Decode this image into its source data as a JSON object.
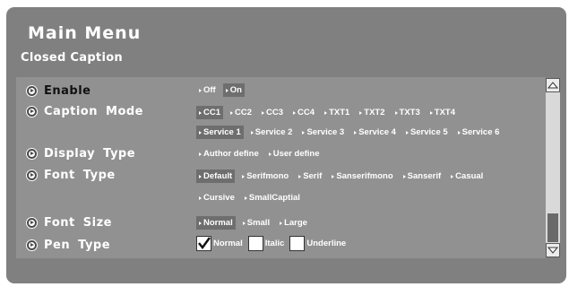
{
  "title": "Main Menu",
  "subtitle": "Closed Caption",
  "rows": [
    {
      "label": "Enable",
      "options": [
        "Off",
        "On"
      ]
    },
    {
      "label": "Caption Mode",
      "options": [
        "CC1",
        "CC2",
        "CC3",
        "CC4",
        "TXT1",
        "TXT2",
        "TXT3",
        "TXT4"
      ],
      "options2": [
        "Service 1",
        "Service 2",
        "Service 3",
        "Service 4",
        "Service 5",
        "Service 6"
      ]
    },
    {
      "label": "Display Type",
      "options": [
        "Author define",
        "User define"
      ]
    },
    {
      "label": "Font Type",
      "options": [
        "Default",
        "Serifmono",
        "Serif",
        "Sanserifmono",
        "Sanserif",
        "Casual"
      ],
      "options2": [
        "Cursive",
        "SmallCaptial"
      ]
    },
    {
      "label": "Font Size",
      "options": [
        "Normal",
        "Small",
        "Large"
      ]
    },
    {
      "label": "Pen Type",
      "checks": [
        "Normal",
        "Italic",
        "Underline"
      ]
    }
  ],
  "colors": {
    "panel": "#808080",
    "menu_area": "#919191",
    "selected_bg": "#6e6e6e",
    "text": "#ffffff"
  }
}
